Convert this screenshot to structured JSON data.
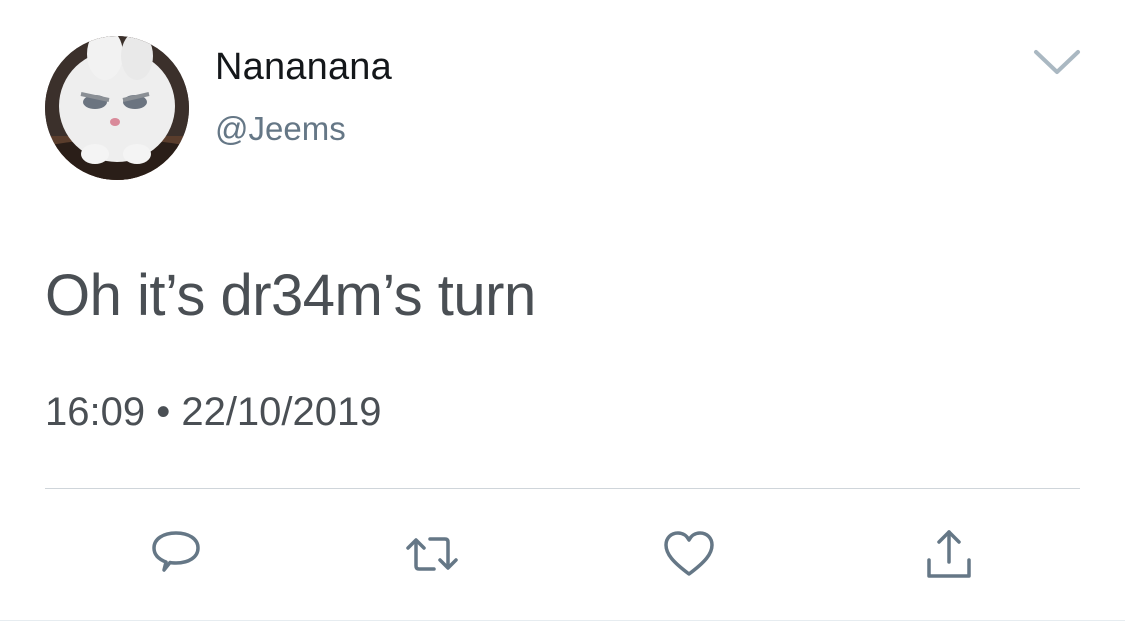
{
  "tweet": {
    "author": {
      "display_name": "Nananana",
      "handle": "@Jeems",
      "avatar_icon": "avatar-icon"
    },
    "text": "Oh it’s dr34m’s turn",
    "timestamp": "16:09 • 22/10/2019"
  },
  "actions": {
    "reply_icon": "reply-icon",
    "retweet_icon": "retweet-icon",
    "like_icon": "heart-icon",
    "share_icon": "share-icon"
  },
  "colors": {
    "text_primary": "#14171a",
    "text_secondary": "#657786",
    "icon": "#657786",
    "divider": "#cfd5da"
  }
}
